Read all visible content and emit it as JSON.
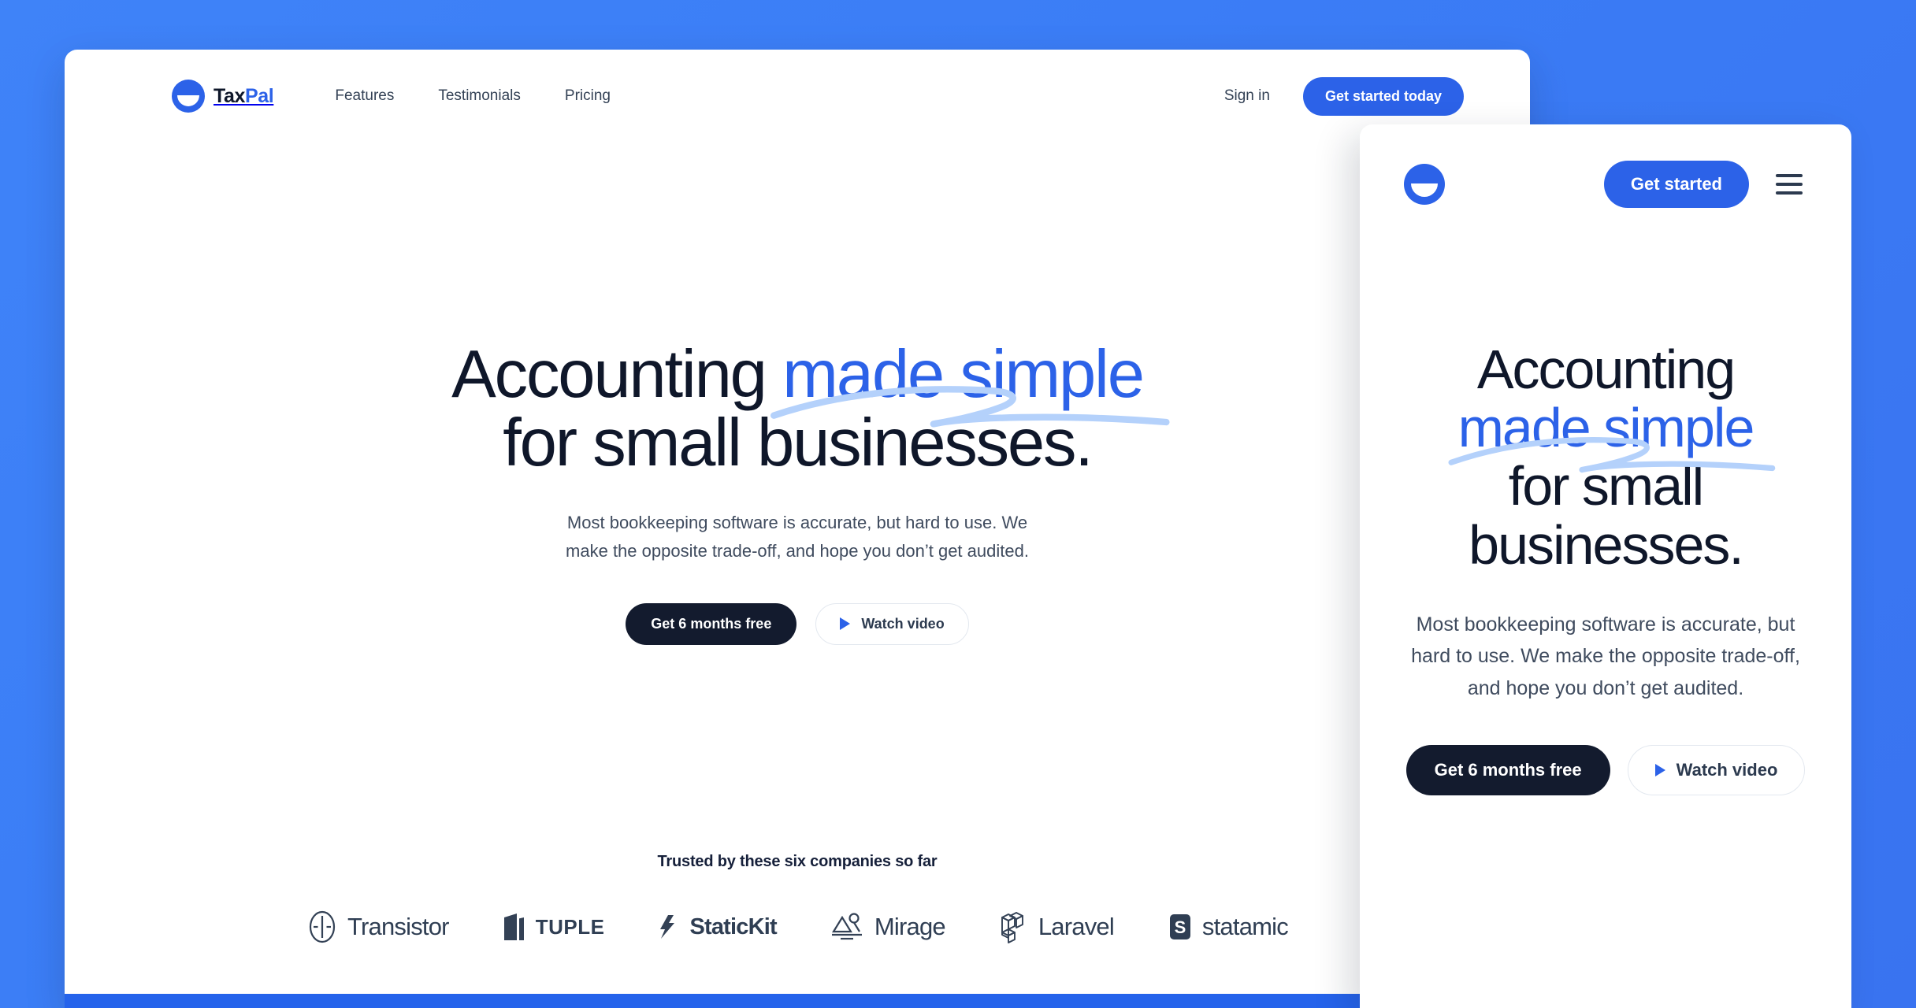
{
  "theme": {
    "background_blue": "#3b7df6",
    "brand_blue": "#2c62e8",
    "dark": "#131b2e",
    "swoosh_blue": "#b4d1fb",
    "body_text": "#3f4b5e"
  },
  "desktop": {
    "brand": {
      "name_first": "Tax",
      "name_second": "Pal",
      "logo_icon": "taxpal-logo-icon"
    },
    "nav": [
      {
        "label": "Features"
      },
      {
        "label": "Testimonials"
      },
      {
        "label": "Pricing"
      }
    ],
    "sign_in_label": "Sign in",
    "get_started_label": "Get started today",
    "headline": {
      "part1": "Accounting ",
      "highlight": "made simple",
      "part2": "for small businesses."
    },
    "subcopy": "Most bookkeeping software is accurate, but hard to use. We make the opposite trade-off, and hope you don’t get audited.",
    "cta_primary": "Get 6 months free",
    "cta_secondary": "Watch video",
    "trusted_label": "Trusted by these six companies so far",
    "logos": [
      {
        "name": "Transistor",
        "icon": "transistor-logo-icon",
        "style": "regular"
      },
      {
        "name": "TUPLE",
        "icon": "tuple-logo-icon",
        "style": "caps"
      },
      {
        "name": "StaticKit",
        "icon": "statickit-logo-icon",
        "style": "bold"
      },
      {
        "name": "Mirage",
        "icon": "mirage-logo-icon",
        "style": "regular"
      },
      {
        "name": "Laravel",
        "icon": "laravel-logo-icon",
        "style": "regular"
      },
      {
        "name": "statamic",
        "icon": "statamic-logo-icon",
        "style": "regular"
      }
    ]
  },
  "mobile": {
    "brand": {
      "logo_icon": "taxpal-logo-icon"
    },
    "get_started_label": "Get started",
    "menu_icon": "hamburger-menu-icon",
    "headline": {
      "part1": "Accounting",
      "highlight": "made simple",
      "part2": "for small businesses."
    },
    "subcopy": "Most bookkeeping software is accurate, but hard to use. We make the opposite trade-off, and hope you don’t get audited.",
    "cta_primary": "Get 6 months free",
    "cta_secondary": "Watch video"
  }
}
